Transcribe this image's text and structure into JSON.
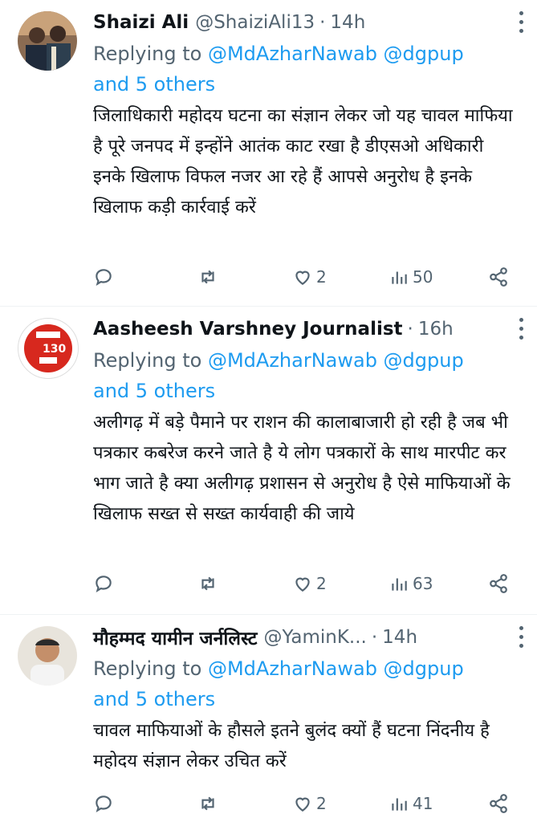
{
  "tweets": [
    {
      "name": "Shaizi Ali",
      "handle": "@ShaiziAli13",
      "separator": "·",
      "time": "14h",
      "reply_prefix": "Replying to",
      "reply_mentions": "@MdAzharNawab @dgpup",
      "reply_others": "and 5 others",
      "text": "जिलाधिकारी महोदय घटना का संज्ञान लेकर जो यह चावल माफिया है पूरे जनपद में इन्होंने आतंक काट रखा है डीएसओ अधिकारी इनके खिलाफ विफल नजर आ रहे हैं आपसे अनुरोध है इनके खिलाफ कड़ी कार्रवाई करें",
      "likes": "2",
      "views": "50",
      "avatar_icon": "user-photo"
    },
    {
      "name": "Aasheesh Varshney Journalist",
      "handle": "",
      "separator": "·",
      "time": "16h",
      "reply_prefix": "Replying to",
      "reply_mentions": "@MdAzharNawab @dgpup",
      "reply_others": "and 5 others",
      "text": "अलीगढ़ में बड़े पैमाने पर राशन की कालाबाजारी हो रही है जब भी पत्रकार कबरेज करने जाते है ये लोग पत्रकारों के साथ मारपीट कर भाग जाते है क्या अलीगढ़ प्रशासन से अनुरोध है ऐसे माफियाओं के खिलाफ सख्त से सख्त कार्यवाही की जाये",
      "likes": "2",
      "views": "63",
      "avatar_icon": "channel-logo",
      "avatar_text": "130"
    },
    {
      "name": "मौहम्मद यामीन जर्नलिस्ट",
      "handle": "@YaminK...",
      "separator": "·",
      "time": "14h",
      "reply_prefix": "Replying to",
      "reply_mentions": "@MdAzharNawab @dgpup",
      "reply_others": "and 5 others",
      "text": "चावल माफियाओं के हौसले इतने बुलंद क्यों हैं घटना निंदनीय है महोदय संज्ञान लेकर उचित करें",
      "likes": "2",
      "views": "41",
      "avatar_icon": "user-photo"
    }
  ],
  "icons": {
    "reply": "reply-bubble-icon",
    "retweet": "retweet-icon",
    "like": "heart-icon",
    "views": "analytics-icon",
    "share": "share-icon",
    "more": "more-icon"
  },
  "colors": {
    "link": "#1d9bf0",
    "secondary": "#536471",
    "text": "#0f1419",
    "divider": "#eff3f4"
  }
}
